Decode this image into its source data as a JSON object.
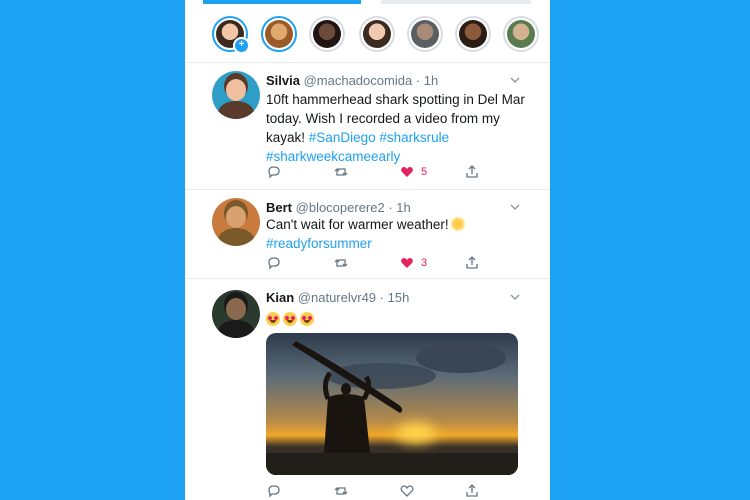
{
  "stories": {
    "items": [
      {
        "name": "story-own",
        "ring": "unseen",
        "skin": "#f4c6a8",
        "hair": "#3b2a1f",
        "add": true
      },
      {
        "name": "story-2",
        "ring": "unseen",
        "skin": "#e0a96d",
        "hair": "#9a5a2a"
      },
      {
        "name": "story-3",
        "ring": "seen",
        "skin": "#6b4a3a",
        "hair": "#1f1512"
      },
      {
        "name": "story-4",
        "ring": "seen",
        "skin": "#f1c9b1",
        "hair": "#3a2a20"
      },
      {
        "name": "story-5",
        "ring": "seen",
        "skin": "#a88b77",
        "hair": "#5c5f62"
      },
      {
        "name": "story-6",
        "ring": "seen",
        "skin": "#8a5a3b",
        "hair": "#2a1d14"
      },
      {
        "name": "story-7",
        "ring": "seen",
        "skin": "#d3b28f",
        "hair": "#5a7a4f"
      }
    ],
    "add_symbol": "+"
  },
  "tweets": [
    {
      "name": "Silvia",
      "handle": "@machadocomida",
      "time": "· 1h",
      "text": "10ft hammerhead shark spotting in Del Mar today. Wish I recorded a video from my kayak!",
      "hashtags": [
        "#SanDiego",
        "#sharksrule",
        "#sharkweekcameearly"
      ],
      "likes": "5",
      "liked": true,
      "avatar": {
        "bg": "#2f9fc7",
        "skin": "#f0c0a0",
        "hair": "#5a3a2a"
      }
    },
    {
      "name": "Bert",
      "handle": "@blocoperere2",
      "time": "· 1h",
      "text": "Can't wait for warmer weather!",
      "hashtags": [
        "#readyforsummer"
      ],
      "likes": "3",
      "liked": true,
      "avatar": {
        "bg": "#c97a3d",
        "skin": "#d9a070",
        "hair": "#7a5a2a"
      }
    },
    {
      "name": "Kian",
      "handle": "@naturelvr49",
      "time": "· 15h",
      "text": "",
      "hashtags": [],
      "likes": "",
      "liked": false,
      "avatar": {
        "bg": "#2b3a2f",
        "skin": "#8a6a4e",
        "hair": "#1a1a1a"
      }
    }
  ],
  "colors": {
    "accent": "#1da1f2",
    "like": "#e0245e",
    "muted": "#657786"
  }
}
